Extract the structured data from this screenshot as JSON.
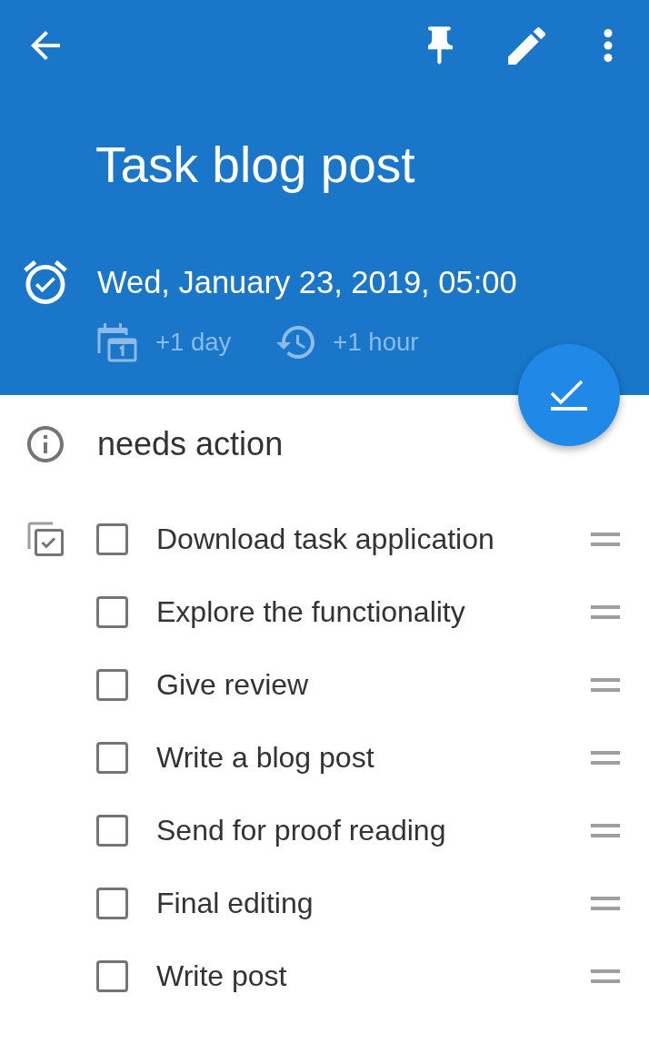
{
  "title": "Task blog post",
  "due": {
    "date": "Wed, January 23, 2019, 05:00",
    "shortcuts": [
      {
        "kind": "day",
        "label": "+1 day"
      },
      {
        "kind": "hour",
        "label": "+1 hour"
      }
    ]
  },
  "status": "needs action",
  "checklist": [
    {
      "text": "Download task application",
      "checked": false
    },
    {
      "text": "Explore the functionality",
      "checked": false
    },
    {
      "text": "Give review",
      "checked": false
    },
    {
      "text": "Write a blog post",
      "checked": false
    },
    {
      "text": "Send for proof reading",
      "checked": false
    },
    {
      "text": "Final editing",
      "checked": false
    },
    {
      "text": "Write post",
      "checked": false
    }
  ]
}
